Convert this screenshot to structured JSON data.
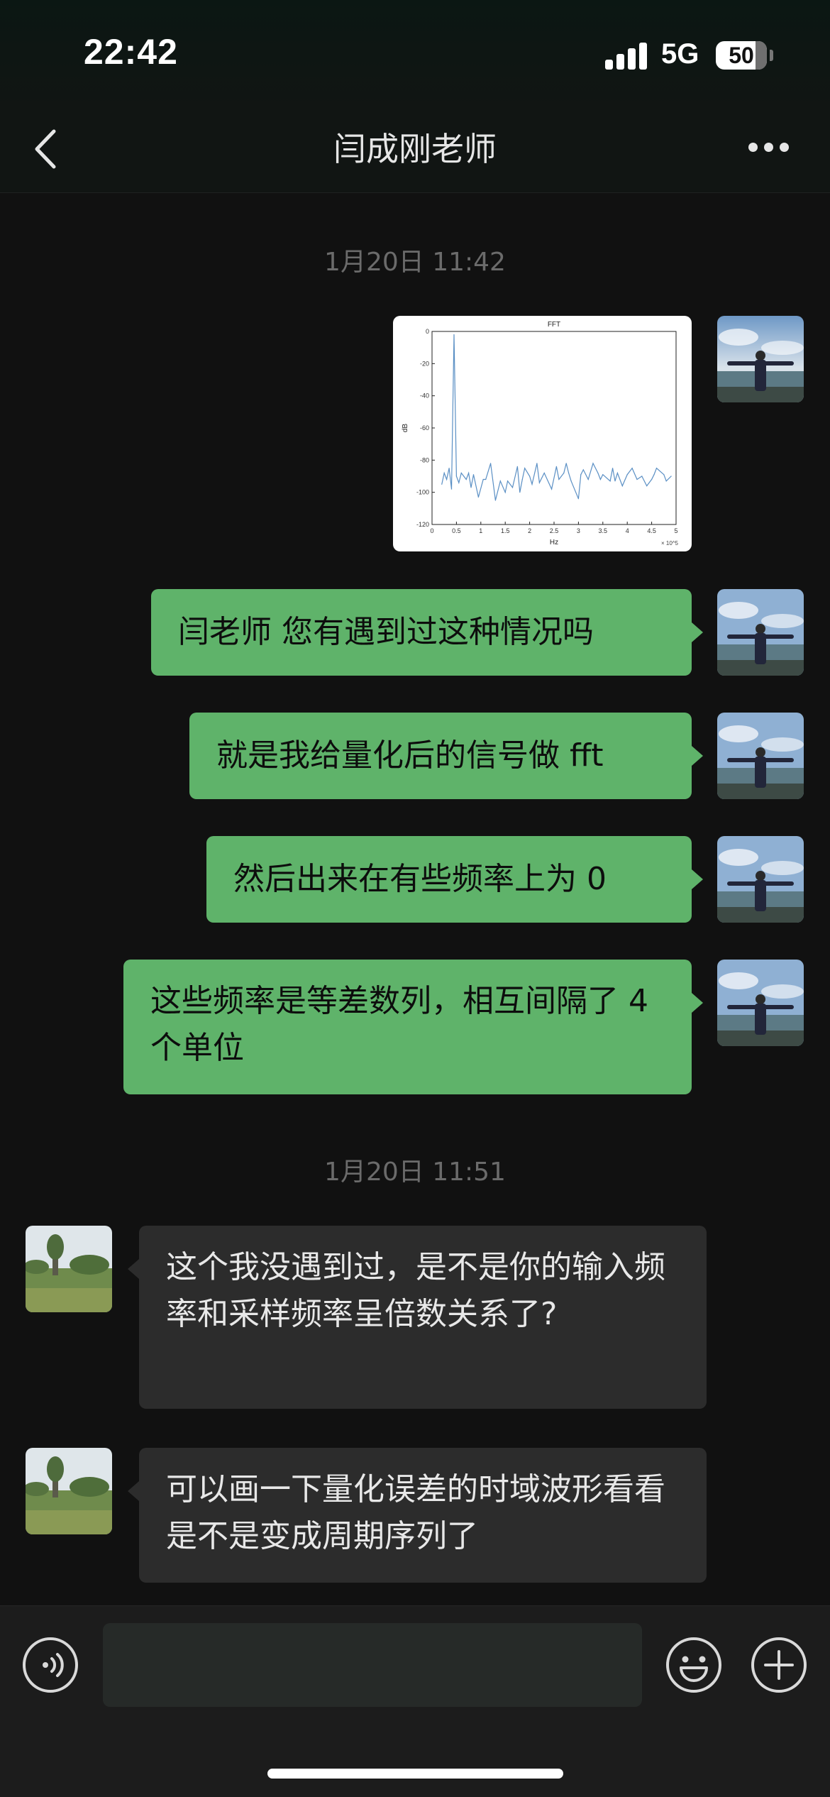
{
  "status_bar": {
    "time": "22:42",
    "network": "5G",
    "battery": "50"
  },
  "header": {
    "title": "闫成刚老师"
  },
  "chat": {
    "timestamps": [
      "1月20日 11:42",
      "1月20日 11:51"
    ],
    "image_message": {
      "chart_data": {
        "type": "line",
        "title": "FFT",
        "xlabel": "Hz",
        "ylabel": "dB",
        "x_multiplier": "× 10^5",
        "xlim": [
          0,
          5
        ],
        "ylim": [
          -120,
          0
        ],
        "xticks": [
          "0",
          "0.5",
          "1",
          "1.5",
          "2",
          "2.5",
          "3",
          "3.5",
          "4",
          "4.5",
          "5"
        ],
        "yticks": [
          "0",
          "-20",
          "-40",
          "-60",
          "-80",
          "-100",
          "-120"
        ],
        "series": [
          {
            "x": [
              0.2,
              0.25,
              0.3,
              0.35,
              0.4,
              0.45,
              0.5,
              0.55,
              0.6,
              0.7,
              0.75,
              0.8,
              0.85,
              0.95,
              1.05,
              1.1,
              1.2,
              1.3,
              1.4,
              1.5,
              1.55,
              1.65,
              1.75,
              1.8,
              1.85,
              1.9,
              2.0,
              2.05,
              2.15,
              2.2,
              2.3,
              2.45,
              2.55,
              2.6,
              2.7,
              2.75,
              2.8,
              2.85,
              3.0,
              3.05,
              3.1,
              3.2,
              3.3,
              3.4,
              3.45,
              3.5,
              3.65,
              3.7,
              3.75,
              3.8,
              3.9,
              4.0,
              4.1,
              4.2,
              4.3,
              4.4,
              4.5,
              4.55,
              4.6,
              4.75,
              4.8,
              4.9
            ],
            "y": [
              -95,
              -88,
              -92,
              -85,
              -98,
              -2,
              -90,
              -94,
              -88,
              -92,
              -88,
              -97,
              -89,
              -103,
              -92,
              -92,
              -82,
              -105,
              -93,
              -100,
              -93,
              -97,
              -84,
              -100,
              -92,
              -85,
              -90,
              -95,
              -82,
              -94,
              -88,
              -98,
              -84,
              -92,
              -88,
              -82,
              -88,
              -93,
              -104,
              -89,
              -86,
              -92,
              -82,
              -88,
              -92,
              -89,
              -93,
              -85,
              -93,
              -88,
              -96,
              -89,
              -85,
              -92,
              -90,
              -96,
              -92,
              -89,
              -85,
              -89,
              -93,
              -90
            ]
          }
        ]
      }
    },
    "messages": [
      {
        "sender": "me",
        "text": "闫老师 您有遇到过这种情况吗"
      },
      {
        "sender": "me",
        "text": "就是我给量化后的信号做 fft"
      },
      {
        "sender": "me",
        "text": "然后出来在有些频率上为 0"
      },
      {
        "sender": "me",
        "text": "这些频率是等差数列，相互间隔了 4 个单位"
      },
      {
        "sender": "other",
        "text": "这个我没遇到过，是不是你的输入频率和采样频率呈倍数关系了?"
      },
      {
        "sender": "other",
        "text": "可以画一下量化误差的时域波形看看是不是变成周期序列了"
      }
    ]
  },
  "input_bar": {
    "placeholder": ""
  },
  "icons": {
    "back": "back-chevron-icon",
    "more": "more-dots-icon",
    "voice": "voice-icon",
    "emoji": "emoji-icon",
    "plus": "plus-icon"
  },
  "colors": {
    "my_bubble": "#5fb36a",
    "other_bubble": "#2c2c2c",
    "background": "#111111"
  }
}
